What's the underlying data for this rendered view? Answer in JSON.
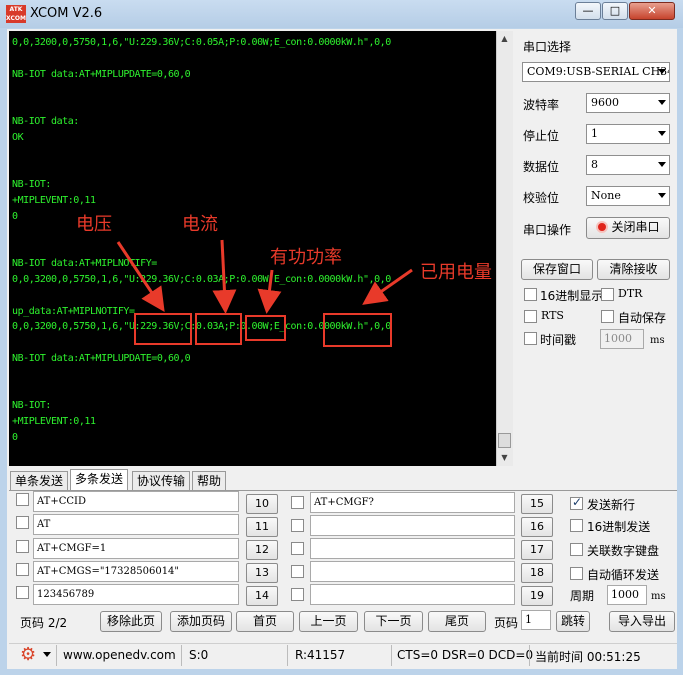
{
  "window": {
    "title": "XCOM V2.6",
    "logo_text": "ATK XCOM",
    "min": "—",
    "max": "□",
    "close": "✕"
  },
  "terminal": {
    "lines": [
      "0,0,3200,0,5750,1,6,\"U:229.36V;C:0.05A;P:0.00W;E_con:0.0000kW.h\",0,0",
      "",
      "NB-IOT data:AT+MIPLUPDATE=0,60,0",
      "",
      "",
      "NB-IOT data:",
      "OK",
      "",
      "",
      "NB-IOT:",
      "+MIPLEVENT:0,11",
      "0",
      "",
      "",
      "NB-IOT data:AT+MIPLNOTIFY=",
      "0,0,3200,0,5750,1,6,\"U:229.36V;C:0.03A;P:0.00W;E_con:0.0000kW.h\",0,0",
      "",
      "up_data:AT+MIPLNOTIFY=",
      "0,0,3200,0,5750,1,6,\"U:229.36V;C:0.03A;P:0.00W;E_con:0.0000kW.h\",0,0",
      "",
      "NB-IOT data:AT+MIPLUPDATE=0,60,0",
      "",
      "",
      "NB-IOT:",
      "+MIPLEVENT:0,11",
      "0"
    ]
  },
  "annotations": {
    "voltage": "电压",
    "current": "电流",
    "active_power": "有功功率",
    "energy_used": "已用电量"
  },
  "serial": {
    "port_label": "串口选择",
    "port_value": "COM9:USB-SERIAL CH340",
    "baud_label": "波特率",
    "baud_value": "9600",
    "stop_label": "停止位",
    "stop_value": "1",
    "data_label": "数据位",
    "data_value": "8",
    "parity_label": "校验位",
    "parity_value": "None",
    "op_label": "串口操作",
    "close_port": "关闭串口",
    "save_window": "保存窗口",
    "clear_recv": "清除接收",
    "hex_display": "16进制显示",
    "dtr": "DTR",
    "rts": "RTS",
    "auto_save": "自动保存",
    "timestamp": "时间戳",
    "ms_value": "1000",
    "ms_unit": "ms"
  },
  "tabs": [
    "单条发送",
    "多条发送",
    "协议传输",
    "帮助"
  ],
  "multi": {
    "left": [
      {
        "text": "AT+CCID",
        "n": "10"
      },
      {
        "text": "AT",
        "n": "11"
      },
      {
        "text": "AT+CMGF=1",
        "n": "12"
      },
      {
        "text": "AT+CMGS=\"17328506014\"",
        "n": "13"
      },
      {
        "text": "123456789",
        "n": "14"
      }
    ],
    "right": [
      {
        "text": "AT+CMGF?",
        "n": "15"
      },
      {
        "text": "",
        "n": "16"
      },
      {
        "text": "",
        "n": "17"
      },
      {
        "text": "",
        "n": "18"
      },
      {
        "text": "",
        "n": "19"
      }
    ],
    "send_newline": "发送新行",
    "hex_send": "16进制发送",
    "link_keypad": "关联数字键盘",
    "auto_loop": "自动循环发送",
    "period_label": "周期",
    "period_value": "1000",
    "period_unit": "ms",
    "page_label": "页码 2/2",
    "remove_page": "移除此页",
    "add_page": "添加页码",
    "first_page": "首页",
    "prev_page": "上一页",
    "next_page": "下一页",
    "last_page": "尾页",
    "page_num_label": "页码",
    "page_num_value": "1",
    "jump": "跳转",
    "import_export": "导入导出"
  },
  "status": {
    "url": "www.openedv.com",
    "sent": "S:0",
    "recv": "R:41157",
    "lines": "CTS=0 DSR=0 DCD=0",
    "time": "当前时间 00:51:25"
  },
  "colors": {
    "terminal_text": "#2ef22e",
    "annotation": "#e83a2a"
  }
}
